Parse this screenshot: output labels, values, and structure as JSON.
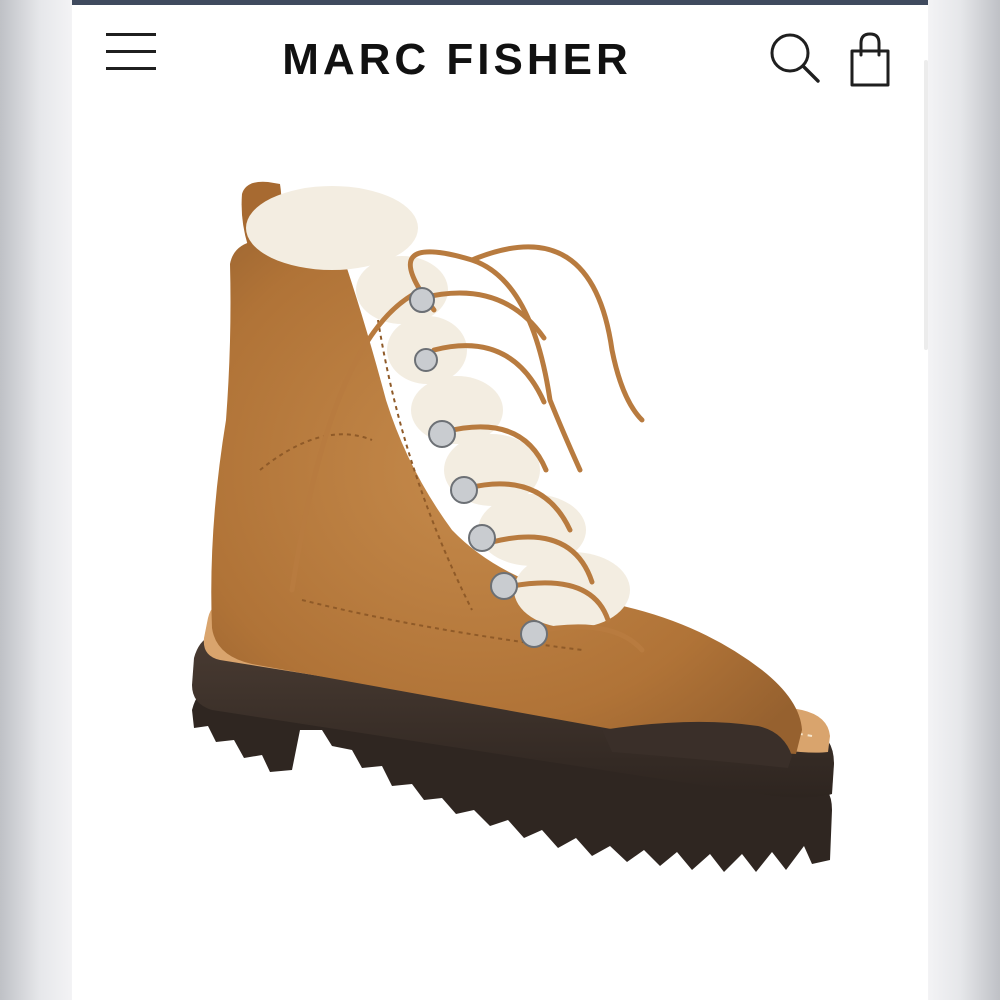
{
  "header": {
    "brand": "MARC FISHER",
    "menu_icon": "hamburger-menu-icon",
    "search_icon": "search-icon",
    "bag_icon": "shopping-bag-icon"
  },
  "product": {
    "image": "suede-shearling-lace-up-hiker-boot"
  },
  "colors": {
    "top_bar": "#3f4a5e",
    "suede": "#b87b3f",
    "shearling": "#f3ede1",
    "sole": "#3d322b",
    "welt": "#d9a46d"
  }
}
